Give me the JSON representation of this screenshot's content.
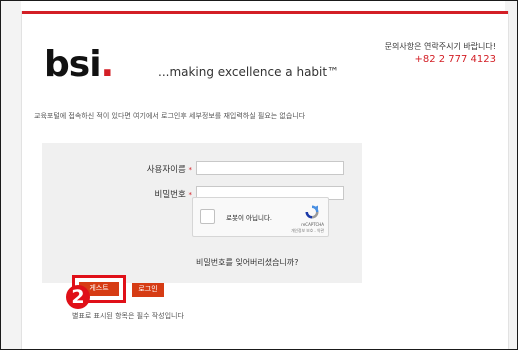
{
  "brand": {
    "logo_text": "bsi",
    "logo_dot": ".",
    "tagline": "...making excellence a habit™",
    "accent_color": "#d31f26"
  },
  "contact": {
    "question": "문의사항은 연락주시기 바랍니다!",
    "phone": "+82 2 777 4123"
  },
  "notice": "교육포털에 접속하신 적이 있다면 여기에서 로그인후 세부정보를 재입력하실 필요는 없습니다",
  "form": {
    "username_label": "사용자이름",
    "password_label": "비밀번호",
    "required_mark": "*",
    "username_value": "",
    "password_value": ""
  },
  "captcha": {
    "checkbox_label": "로봇이 아닙니다.",
    "brand": "reCAPTCHA",
    "links": "개인정보 보호 - 약관",
    "icon": "recaptcha-icon"
  },
  "forgot_password": "비밀번호를 잊어버리셨습니까?",
  "buttons": {
    "guest": "게스트",
    "login": "로그인",
    "color": "#d63c14"
  },
  "annotation": {
    "step": "2",
    "color": "#e01018"
  },
  "footnote": "별표로 표시된 항목은 필수 작성입니다"
}
